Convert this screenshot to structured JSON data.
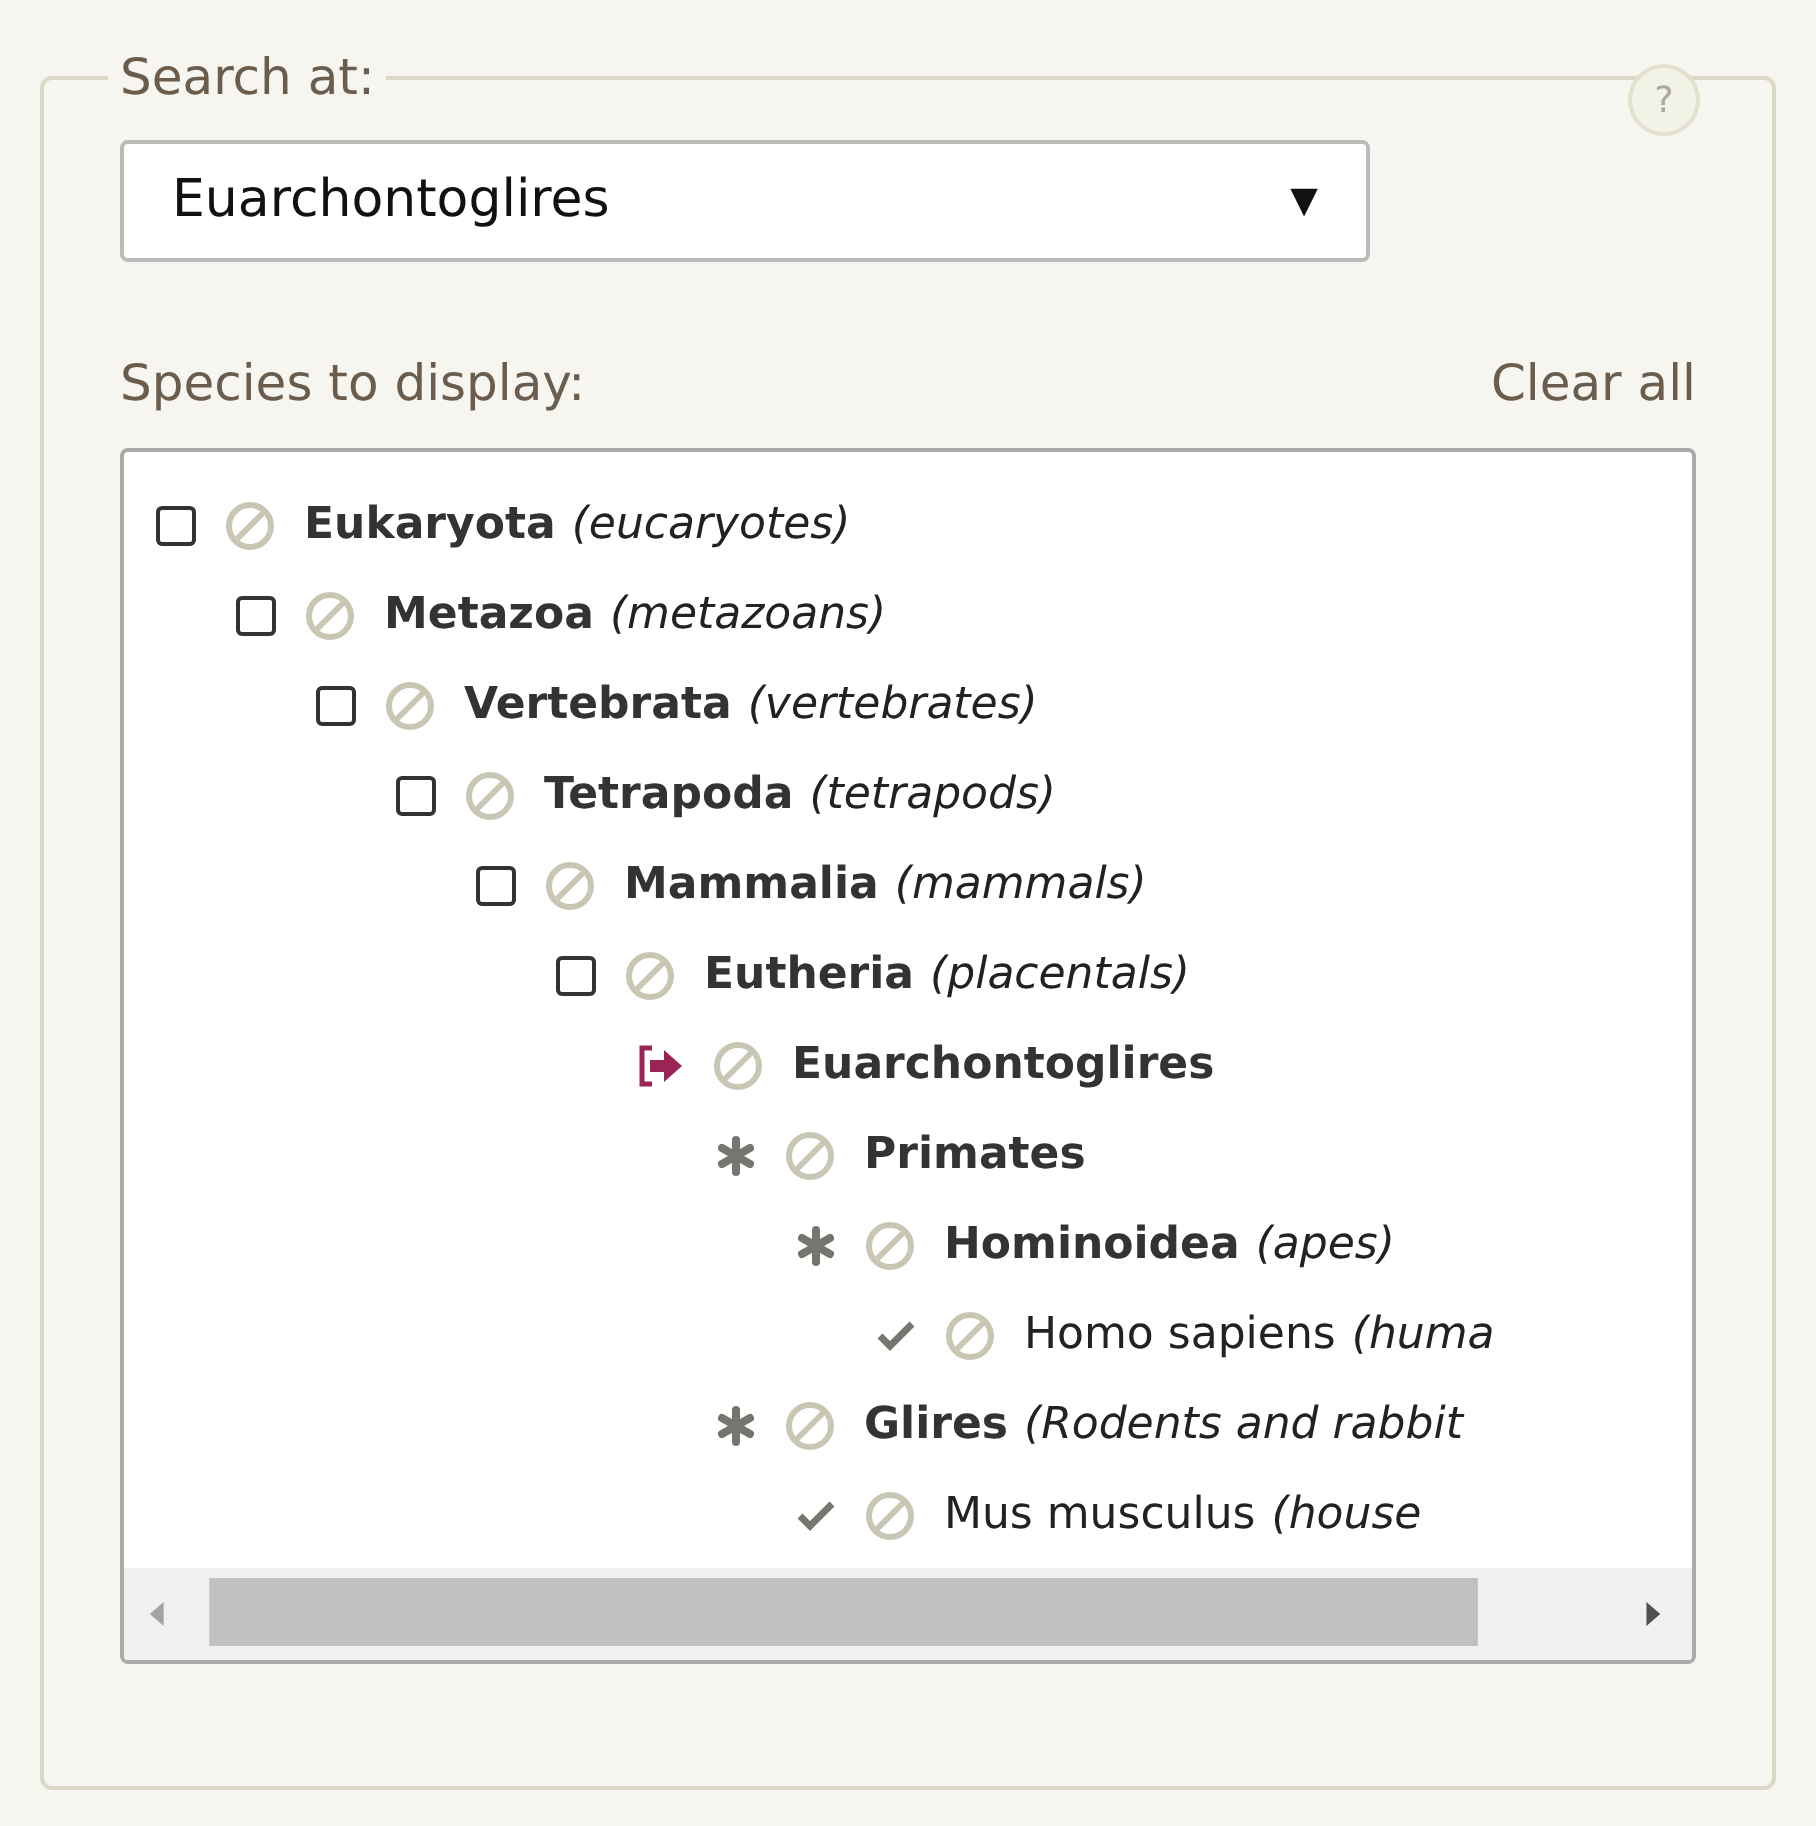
{
  "search": {
    "legend": "Search at:",
    "help": "?",
    "value": "Euarchontoglires",
    "arrow": "▼"
  },
  "species": {
    "label": "Species to display:",
    "clear": "Clear all",
    "tree": [
      {
        "kind": "checkbox",
        "checked": false,
        "name": "Eukaryota",
        "common": "(eucaryotes)",
        "children": [
          {
            "kind": "checkbox",
            "checked": false,
            "name": "Metazoa",
            "common": "(metazoans)",
            "children": [
              {
                "kind": "checkbox",
                "checked": false,
                "name": "Vertebrata",
                "common": "(vertebrates)",
                "children": [
                  {
                    "kind": "checkbox",
                    "checked": false,
                    "name": "Tetrapoda",
                    "common": "(tetrapods)",
                    "children": [
                      {
                        "kind": "checkbox",
                        "checked": false,
                        "name": "Mammalia",
                        "common": "(mammals)",
                        "children": [
                          {
                            "kind": "checkbox",
                            "checked": false,
                            "name": "Eutheria",
                            "common": "(placentals)",
                            "children": [
                              {
                                "kind": "current",
                                "name": "Euarchontoglires",
                                "children": [
                                  {
                                    "kind": "group",
                                    "name": "Primates",
                                    "children": [
                                      {
                                        "kind": "group",
                                        "name": "Hominoidea",
                                        "common": "(apes)",
                                        "children": [
                                          {
                                            "kind": "species",
                                            "name": "Homo sapiens",
                                            "common": "(huma"
                                          }
                                        ]
                                      }
                                    ]
                                  },
                                  {
                                    "kind": "group",
                                    "name": "Glires",
                                    "common": "(Rodents and rabbit",
                                    "children": [
                                      {
                                        "kind": "species",
                                        "name": "Mus musculus",
                                        "common": "(house"
                                      }
                                    ]
                                  }
                                ]
                              }
                            ]
                          }
                        ]
                      }
                    ]
                  }
                ]
              }
            ]
          }
        ]
      }
    ]
  }
}
